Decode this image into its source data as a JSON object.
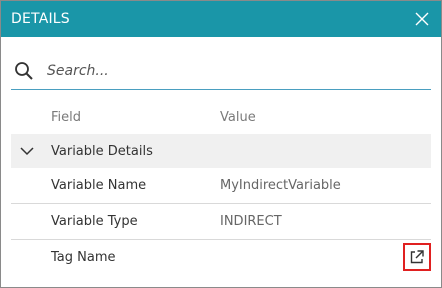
{
  "panel": {
    "title": "DETAILS",
    "header_color": "#1a96a8",
    "close_icon": "close-icon"
  },
  "search": {
    "placeholder": "Search...",
    "value": "",
    "icon": "search-icon"
  },
  "columns": {
    "field": "Field",
    "value": "Value"
  },
  "group": {
    "label": "Variable Details",
    "expanded": true,
    "icon": "chevron-down-icon"
  },
  "rows": [
    {
      "field": "Variable Name",
      "value": "MyIndirectVariable"
    },
    {
      "field": "Variable Type",
      "value": "INDIRECT"
    },
    {
      "field": "Tag Name",
      "value": ""
    }
  ],
  "tag_link": {
    "icon": "external-link-icon",
    "highlight_color": "#e02020"
  }
}
